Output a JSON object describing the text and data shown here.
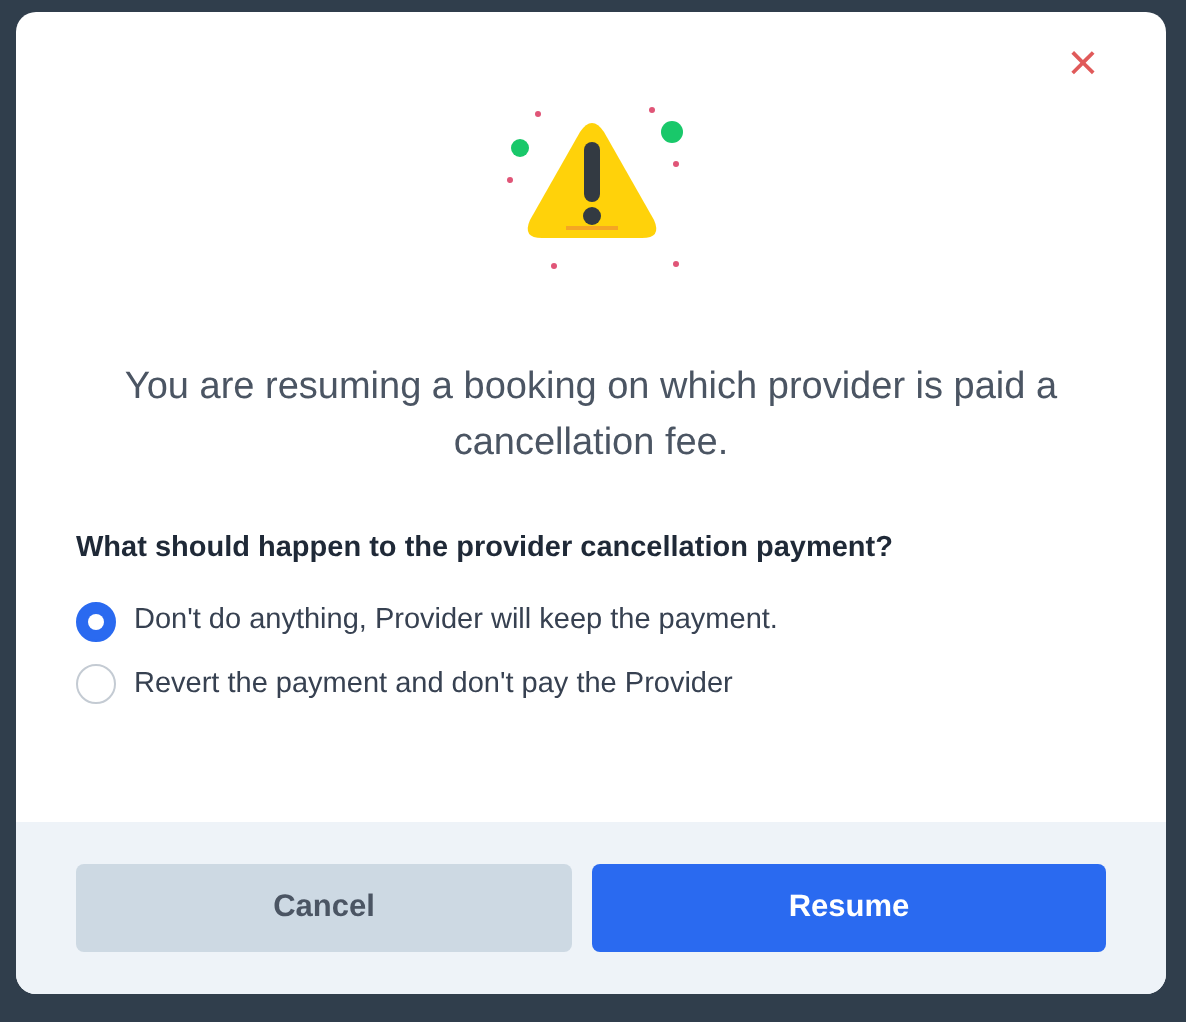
{
  "dialog": {
    "close": "×",
    "message": "You are resuming a booking on which provider is paid a cancellation fee.",
    "question": "What should happen to the provider cancellation payment?",
    "options": [
      {
        "label": "Don't do anything, Provider will keep the payment.",
        "selected": true
      },
      {
        "label": "Revert the payment and don't pay the Provider",
        "selected": false
      }
    ],
    "buttons": [
      {
        "label": "Cancel",
        "kind": "secondary"
      },
      {
        "label": "Resume",
        "kind": "primary"
      }
    ]
  }
}
